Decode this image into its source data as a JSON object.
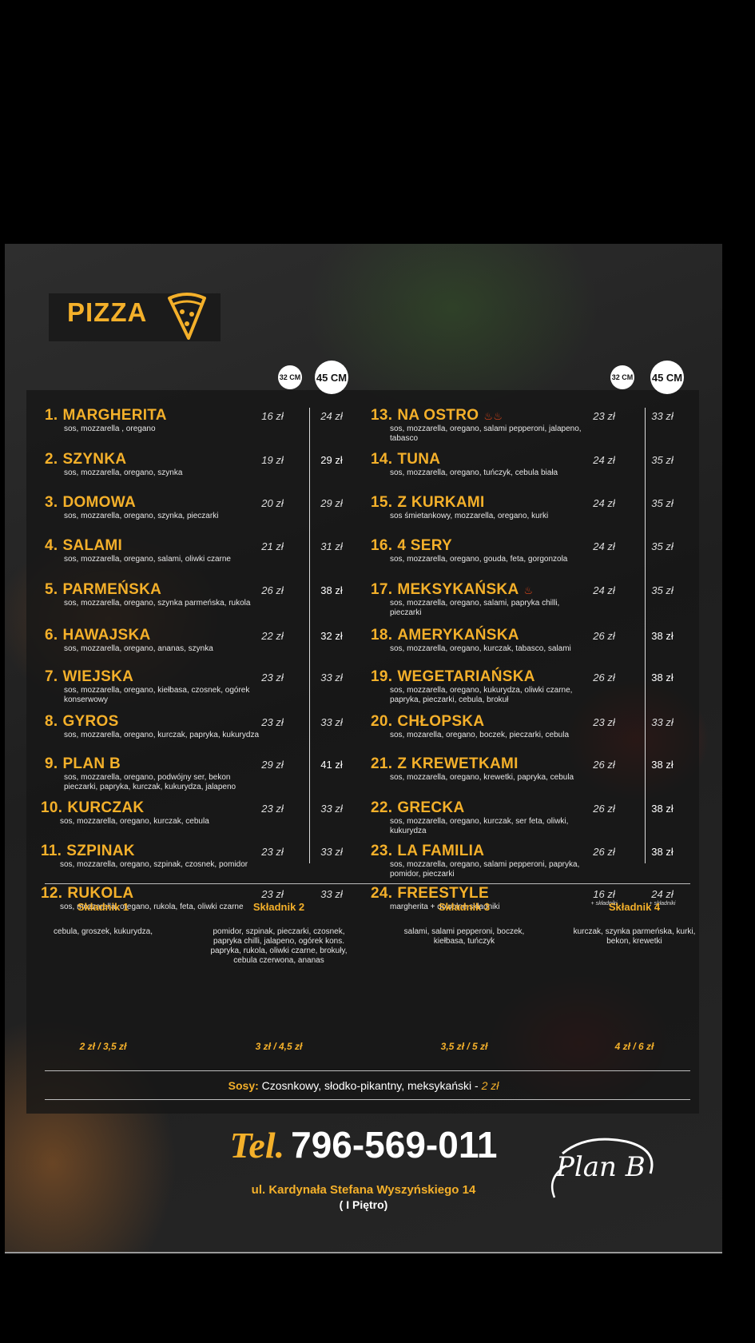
{
  "menu_title": "PIZZA",
  "sizes": {
    "small": "32 CM",
    "large": "45 CM"
  },
  "pizzas": [
    {
      "num": "1.",
      "name": "MARGHERITA",
      "desc": "sos, mozzarella , oregano",
      "p32": "16 zł",
      "p45": "24 zł"
    },
    {
      "num": "2.",
      "name": "SZYNKA",
      "desc": "sos, mozzarella, oregano, szynka",
      "p32": "19 zł",
      "p45": "29 zł"
    },
    {
      "num": "3.",
      "name": "DOMOWA",
      "desc": "sos, mozzarella, oregano, szynka, pieczarki",
      "p32": "20 zł",
      "p45": "29 zł"
    },
    {
      "num": "4.",
      "name": "SALAMI",
      "desc": "sos, mozzarella, oregano, salami, oliwki czarne",
      "p32": "21 zł",
      "p45": "31 zł"
    },
    {
      "num": "5.",
      "name": "PARMEŃSKA",
      "desc": "sos, mozzarella, oregano, szynka parmeńska, rukola",
      "p32": "26 zł",
      "p45": "38 zł"
    },
    {
      "num": "6.",
      "name": "HAWAJSKA",
      "desc": "sos, mozzarella, oregano, ananas, szynka",
      "p32": "22 zł",
      "p45": "32 zł"
    },
    {
      "num": "7.",
      "name": "WIEJSKA",
      "desc": "sos, mozzarella, oregano, kiełbasa, czosnek, ogórek konserwowy",
      "p32": "23 zł",
      "p45": "33 zł"
    },
    {
      "num": "8.",
      "name": "GYROS",
      "desc": "sos, mozzarella, oregano, kurczak, papryka, kukurydza",
      "p32": "23 zł",
      "p45": "33 zł"
    },
    {
      "num": "9.",
      "name": "PLAN B",
      "desc": "sos, mozzarella, oregano, podwójny ser, bekon pieczarki, papryka, kurczak, kukurydza, jalapeno",
      "p32": "29 zł",
      "p45": "41 zł"
    },
    {
      "num": "10.",
      "name": "KURCZAK",
      "desc": "sos, mozzarella, oregano, kurczak, cebula",
      "p32": "23 zł",
      "p45": "33 zł"
    },
    {
      "num": "11.",
      "name": "SZPINAK",
      "desc": "sos, mozzarella, oregano, szpinak, czosnek, pomidor",
      "p32": "23 zł",
      "p45": "33 zł"
    },
    {
      "num": "12.",
      "name": "RUKOLA",
      "desc": "sos, mozzarella, oregano, rukola, feta, oliwki czarne",
      "p32": "23 zł",
      "p45": "33 zł"
    },
    {
      "num": "13.",
      "name": "NA OSTRO",
      "desc": "sos, mozzarella, oregano, salami pepperoni, jalapeno, tabasco",
      "p32": "23 zł",
      "p45": "33 zł"
    },
    {
      "num": "14.",
      "name": "TUNA",
      "desc": "sos, mozzarella, oregano, tuńczyk, cebula biała",
      "p32": "24 zł",
      "p45": "35 zł"
    },
    {
      "num": "15.",
      "name": "Z KURKAMI",
      "desc": "sos śmietankowy, mozzarella, oregano, kurki",
      "p32": "24 zł",
      "p45": "35 zł"
    },
    {
      "num": "16.",
      "name": "4 SERY",
      "desc": "sos, mozzarella, oregano, gouda, feta, gorgonzola",
      "p32": "24 zł",
      "p45": "35 zł"
    },
    {
      "num": "17.",
      "name": "MEKSYKAŃSKA",
      "desc": "sos, mozzarella, oregano, salami, papryka chilli, pieczarki",
      "p32": "24 zł",
      "p45": "35 zł"
    },
    {
      "num": "18.",
      "name": "AMERYKAŃSKA",
      "desc": "sos, mozzarella, oregano, kurczak, tabasco, salami",
      "p32": "26 zł",
      "p45": "38 zł"
    },
    {
      "num": "19.",
      "name": "WEGETARIAŃSKA",
      "desc": "sos, mozzarella, oregano, kukurydza, oliwki czarne, papryka, pieczarki, cebula, brokuł",
      "p32": "26 zł",
      "p45": "38 zł"
    },
    {
      "num": "20.",
      "name": "CHŁOPSKA",
      "desc": "sos, mozarella, oregano, boczek, pieczarki, cebula",
      "p32": "23 zł",
      "p45": "33 zł"
    },
    {
      "num": "21.",
      "name": "Z KREWETKAMI",
      "desc": "sos, mozzarella, oregano, krewetki, papryka, cebula",
      "p32": "26 zł",
      "p45": "38 zł"
    },
    {
      "num": "22.",
      "name": "GRECKA",
      "desc": "sos, mozzarella, oregano, kurczak, ser feta, oliwki, kukurydza",
      "p32": "26 zł",
      "p45": "38 zł"
    },
    {
      "num": "23.",
      "name": "LA FAMILIA",
      "desc": "sos, mozzarella, oregano, salami pepperoni, papryka, pomidor, pieczarki",
      "p32": "26 zł",
      "p45": "38 zł"
    },
    {
      "num": "24.",
      "name": "FREESTYLE",
      "desc": "margherita + dowolne składniki",
      "p32": "16 zł",
      "p45": "24 zł",
      "note32": "+ składniki",
      "note45": "+ składniki"
    }
  ],
  "ingredients": [
    {
      "head": "Składnik 1",
      "list": "cebula, groszek, kukurydza,",
      "price": "2 zł / 3,5 zł"
    },
    {
      "head": "Składnik 2",
      "list": "pomidor, szpinak, pieczarki, czosnek, papryka chilli, jalapeno, ogórek kons. papryka, rukola, oliwki czarne, brokuły, cebula czerwona, ananas",
      "price": "3 zł / 4,5 zł"
    },
    {
      "head": "Składnik 3",
      "list": "salami, salami pepperoni, boczek, kiełbasa, tuńczyk",
      "price": "3,5 zł / 5 zł"
    },
    {
      "head": "Składnik 4",
      "list": "kurczak, szynka parmeńska, kurki, bekon, krewetki",
      "price": "4 zł / 6 zł"
    }
  ],
  "sauces": {
    "label": "Sosy:",
    "list": " Czosnkowy, słodko-pikantny, meksykański - ",
    "price": "2 zł"
  },
  "contact": {
    "tel_label": "Tel.",
    "phone": "796-569-011",
    "address": "ul. Kardynała Stefana Wyszyńskiego 14",
    "floor": "( I Piętro)"
  },
  "logo_text": "Plan B",
  "colors": {
    "accent": "#f4b02a",
    "background": "#1f1f1f"
  }
}
